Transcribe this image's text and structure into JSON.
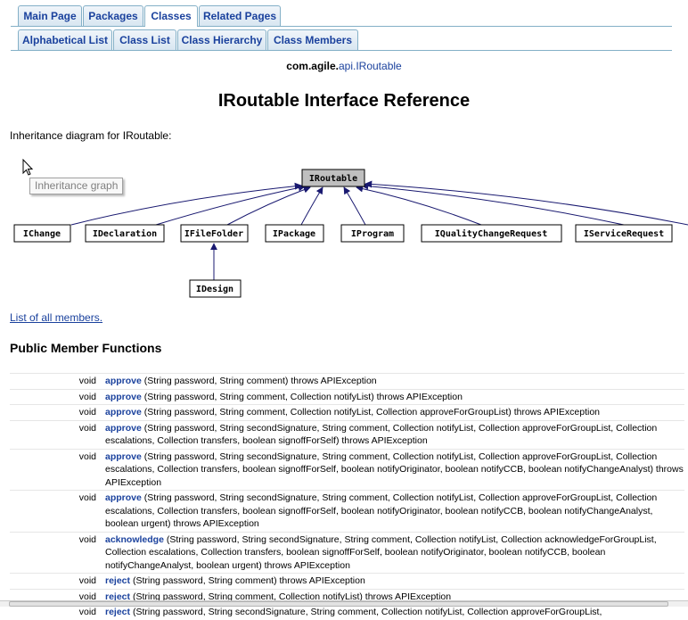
{
  "tabs_primary": [
    {
      "label": "Main Page",
      "active": false
    },
    {
      "label": "Packages",
      "active": false
    },
    {
      "label": "Classes",
      "active": true
    },
    {
      "label": "Related Pages",
      "active": false
    }
  ],
  "tabs_secondary": [
    {
      "label": "Alphabetical List"
    },
    {
      "label": "Class List"
    },
    {
      "label": "Class Hierarchy"
    },
    {
      "label": "Class Members"
    }
  ],
  "nav_path": {
    "prefix": "com.agile.",
    "link": "api.IRoutable"
  },
  "page_title": "IRoutable Interface Reference",
  "inheritance_label": "Inheritance diagram for IRoutable:",
  "tooltip": "Inheritance graph",
  "diagram": {
    "root": "IRoutable",
    "children": [
      "IChange",
      "IDeclaration",
      "IFileFolder",
      "IPackage",
      "IProgram",
      "IQualityChangeRequest",
      "IServiceRequest"
    ],
    "grandchild": "IDesign"
  },
  "all_members_link": "List of all members.",
  "section_title": "Public Member Functions",
  "members": [
    {
      "ret": "void",
      "name": "approve",
      "args": " (String password, String comment) throws APIException"
    },
    {
      "ret": "void",
      "name": "approve",
      "args": " (String password, String comment, Collection notifyList) throws APIException"
    },
    {
      "ret": "void",
      "name": "approve",
      "args": " (String password, String comment, Collection notifyList, Collection approveForGroupList) throws APIException"
    },
    {
      "ret": "void",
      "name": "approve",
      "args": " (String password, String secondSignature, String comment, Collection notifyList, Collection approveForGroupList, Collection escalations, Collection transfers, boolean signoffForSelf) throws APIException"
    },
    {
      "ret": "void",
      "name": "approve",
      "args": " (String password, String secondSignature, String comment, Collection notifyList, Collection approveForGroupList, Collection escalations, Collection transfers, boolean signoffForSelf, boolean notifyOriginator, boolean notifyCCB, boolean notifyChangeAnalyst) throws APIException"
    },
    {
      "ret": "void",
      "name": "approve",
      "args": " (String password, String secondSignature, String comment, Collection notifyList, Collection approveForGroupList, Collection escalations, Collection transfers, boolean signoffForSelf, boolean notifyOriginator, boolean notifyCCB, boolean notifyChangeAnalyst, boolean urgent) throws APIException"
    },
    {
      "ret": "void",
      "name": "acknowledge",
      "args": " (String password, String secondSignature, String comment, Collection notifyList, Collection acknowledgeForGroupList, Collection escalations, Collection transfers, boolean signoffForSelf, boolean notifyOriginator, boolean notifyCCB, boolean notifyChangeAnalyst, boolean urgent) throws APIException"
    },
    {
      "ret": "void",
      "name": "reject",
      "args": " (String password, String comment) throws APIException"
    },
    {
      "ret": "void",
      "name": "reject",
      "args": " (String password, String comment, Collection notifyList) throws APIException"
    },
    {
      "ret": "void",
      "name": "reject",
      "args": " (String password, String secondSignature, String comment, Collection notifyList, Collection approveForGroupList,"
    }
  ],
  "colors": {
    "link": "#1a419d",
    "tab_border": "#84b0c7",
    "root_fill": "#bfbfbf"
  }
}
